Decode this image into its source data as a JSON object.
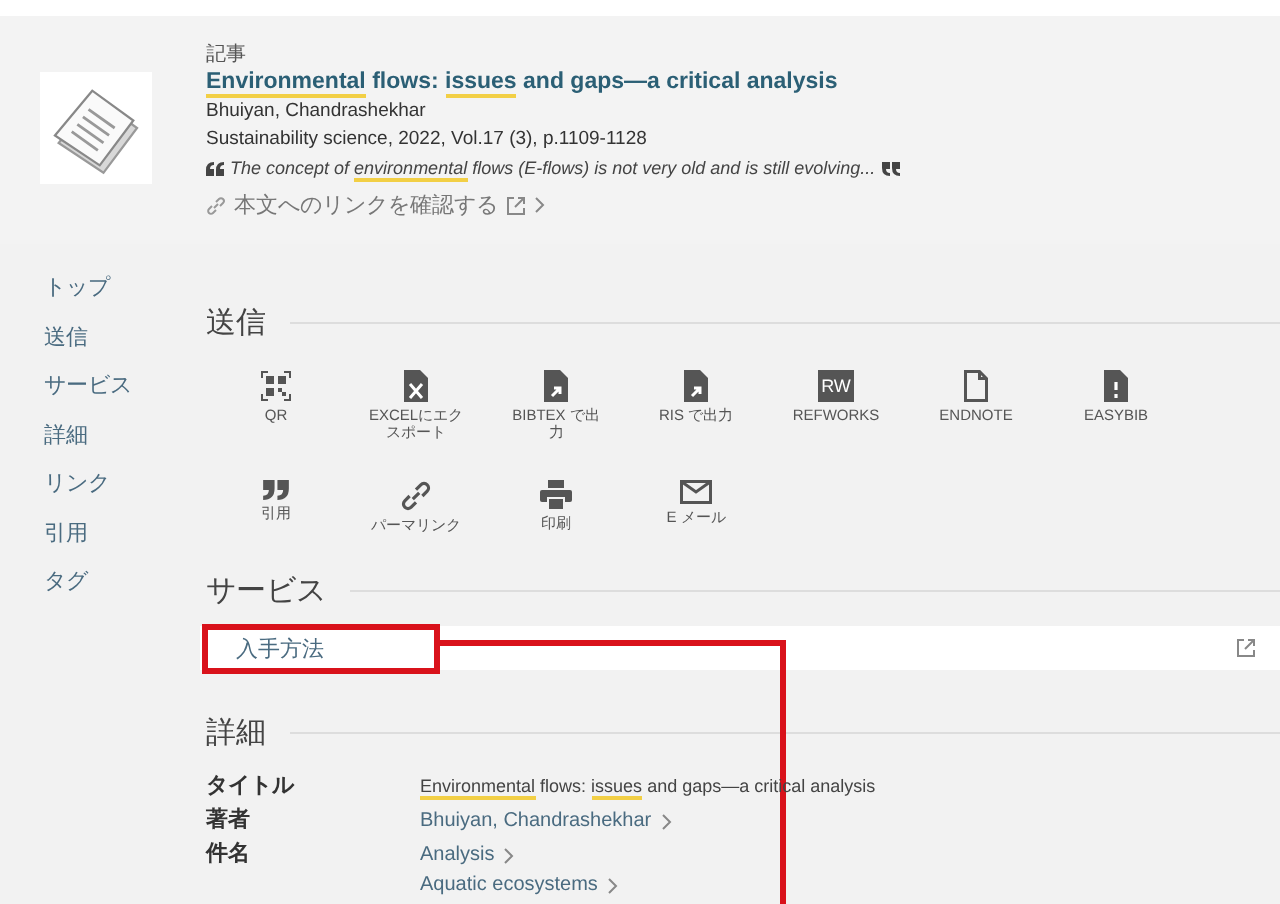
{
  "record": {
    "type_label": "記事",
    "title": [
      {
        "text": "Environmental",
        "highlight": true
      },
      {
        "text": " flows: ",
        "highlight": false
      },
      {
        "text": "issues",
        "highlight": true
      },
      {
        "text": " and gaps—a critical analysis",
        "highlight": false
      }
    ],
    "author": "Bhuiyan, Chandrashekhar",
    "source": "Sustainability science, 2022, Vol.17 (3), p.1109-1128",
    "snippet": [
      {
        "text": "The concept of ",
        "highlight": false
      },
      {
        "text": "environmental",
        "highlight": true
      },
      {
        "text": " flows (E-flows) is not very old and is still evolving...",
        "highlight": false
      }
    ],
    "fulltext_link": "本文へのリンクを確認する"
  },
  "sidebar": {
    "items": [
      {
        "label": "トップ"
      },
      {
        "label": "送信"
      },
      {
        "label": "サービス"
      },
      {
        "label": "詳細"
      },
      {
        "label": "リンク"
      },
      {
        "label": "引用"
      },
      {
        "label": "タグ"
      }
    ]
  },
  "send": {
    "heading": "送信",
    "actions": [
      {
        "kind": "qr",
        "label": "QR"
      },
      {
        "kind": "excel",
        "label": "EXCELにエクスポート"
      },
      {
        "kind": "export",
        "label": "BIBTEX で出力"
      },
      {
        "kind": "export",
        "label": "RIS で出力"
      },
      {
        "kind": "badge",
        "badge": "RW",
        "label": "REFWORKS"
      },
      {
        "kind": "document",
        "label": "ENDNOTE"
      },
      {
        "kind": "easybib",
        "label": "EASYBIB"
      },
      {
        "kind": "quote",
        "label": "引用"
      },
      {
        "kind": "link",
        "label": "パーマリンク"
      },
      {
        "kind": "print",
        "label": "印刷"
      },
      {
        "kind": "mail",
        "label": "E メール"
      }
    ]
  },
  "services": {
    "heading": "サービス",
    "items": [
      {
        "label": "入手方法",
        "annotated": true
      }
    ]
  },
  "details": {
    "heading": "詳細",
    "rows": [
      {
        "label": "タイトル",
        "kind": "text",
        "value": [
          {
            "text": "Environmental",
            "highlight": true
          },
          {
            "text": " flows: ",
            "highlight": false
          },
          {
            "text": "issues",
            "highlight": true
          },
          {
            "text": " and gaps—a critical analysis",
            "highlight": false
          }
        ]
      },
      {
        "label": "著者",
        "kind": "links",
        "links": [
          "Bhuiyan, Chandrashekhar"
        ]
      },
      {
        "label": "件名",
        "kind": "links",
        "links": [
          "Analysis",
          "Aquatic ecosystems"
        ]
      }
    ]
  }
}
